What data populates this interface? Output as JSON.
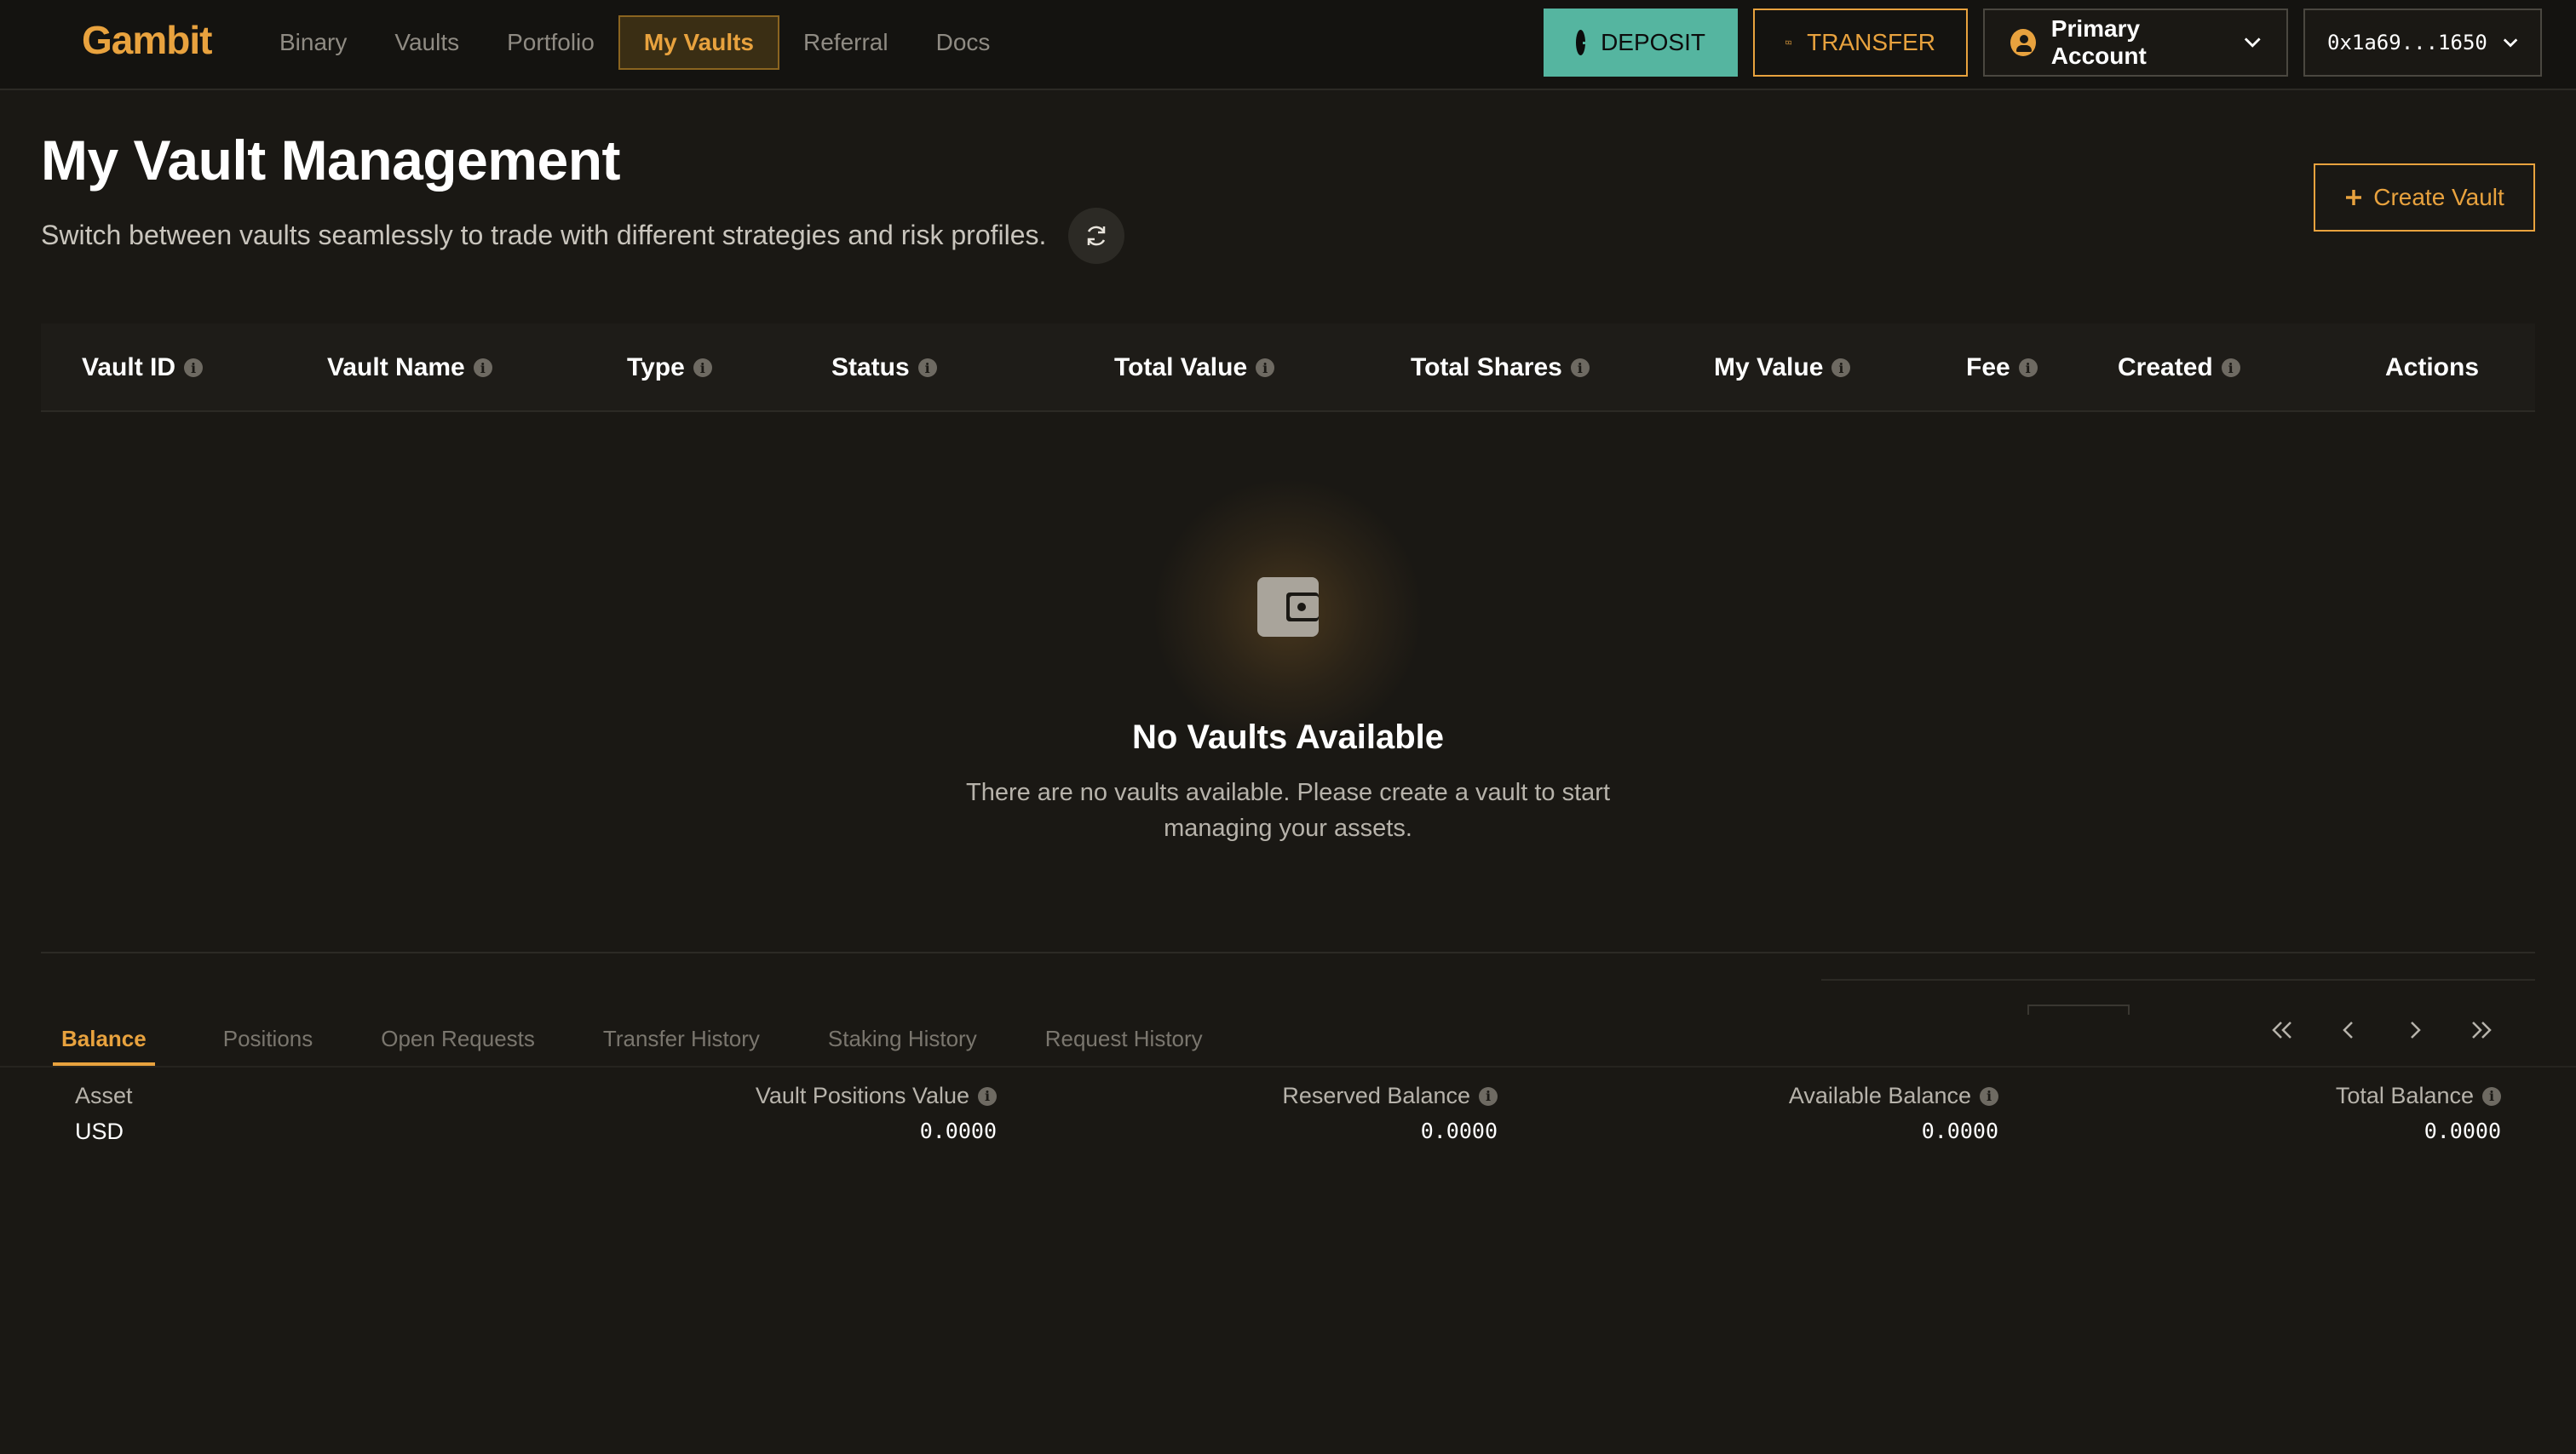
{
  "app": {
    "logo": "Gambit"
  },
  "nav": {
    "items": [
      "Binary",
      "Vaults",
      "Portfolio",
      "My Vaults",
      "Referral",
      "Docs"
    ],
    "active": "My Vaults"
  },
  "top_actions": {
    "deposit": "DEPOSIT",
    "transfer": "TRANSFER",
    "account": "Primary Account",
    "wallet": "0x1a69...1650"
  },
  "page": {
    "title": "My Vault Management",
    "subtitle": "Switch between vaults seamlessly to trade with different strategies and risk profiles.",
    "create_button": "Create Vault"
  },
  "table": {
    "columns": [
      "Vault ID",
      "Vault Name",
      "Type",
      "Status",
      "Total Value",
      "Total Shares",
      "My Value",
      "Fee",
      "Created",
      "Actions"
    ]
  },
  "empty_state": {
    "title": "No Vaults Available",
    "text": "There are no vaults available. Please create a vault to start managing your assets."
  },
  "bottom_tabs": {
    "items": [
      "Balance",
      "Positions",
      "Open Requests",
      "Transfer History",
      "Staking History",
      "Request History"
    ],
    "active": "Balance"
  },
  "balance": {
    "headers": [
      "Asset",
      "Vault Positions Value",
      "Reserved Balance",
      "Available Balance",
      "Total Balance"
    ],
    "rows": [
      {
        "asset": "USD",
        "vault_positions_value": "0.0000",
        "reserved": "0.0000",
        "available": "0.0000",
        "total": "0.0000"
      }
    ]
  },
  "colors": {
    "accent": "#e8a23e",
    "deposit": "#55b5a0",
    "background": "#1a1814"
  },
  "icons": [
    "plus-circle-icon",
    "money-transfer-icon",
    "user-icon",
    "chevron-down-icon",
    "refresh-icon",
    "plus-icon",
    "info-icon",
    "wallet-icon",
    "double-chevron-left-icon",
    "chevron-left-icon",
    "chevron-right-icon",
    "double-chevron-right-icon"
  ]
}
